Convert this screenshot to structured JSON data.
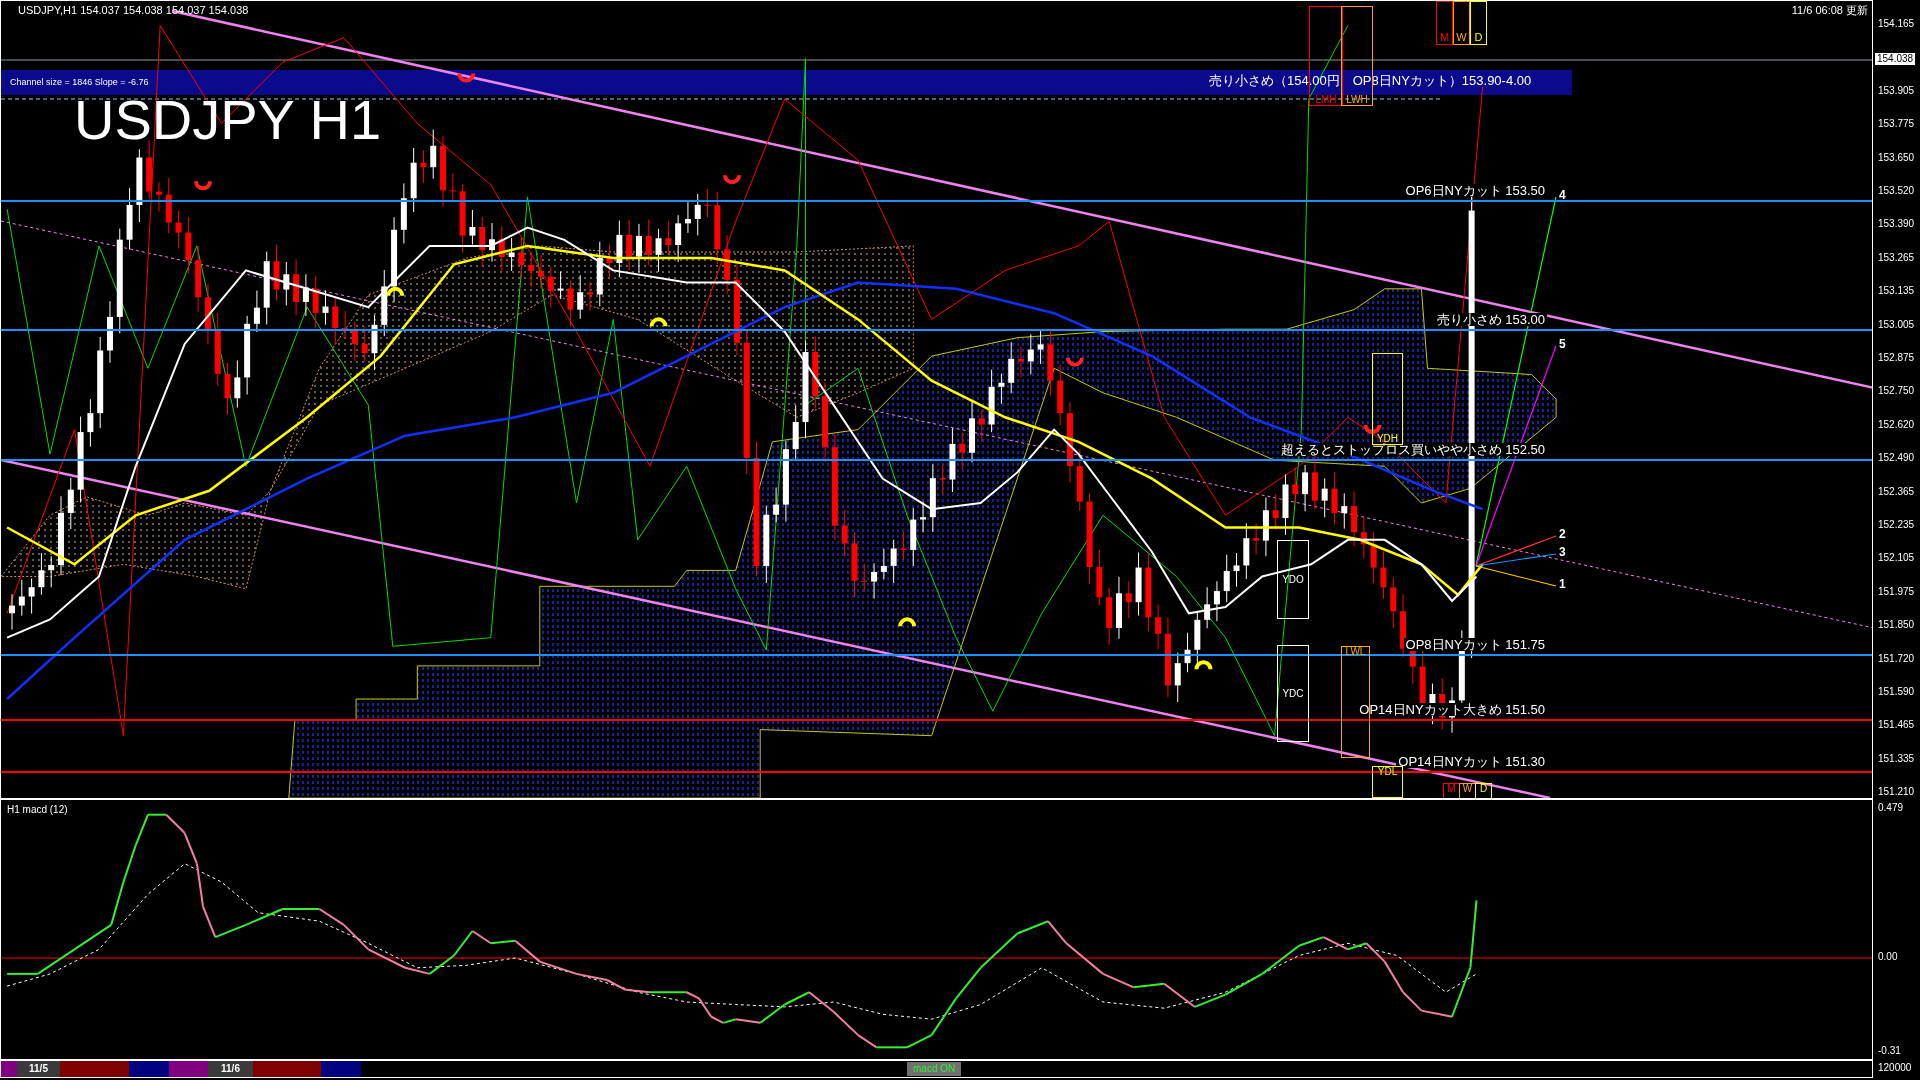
{
  "header": {
    "symbol_info": "USDJPY,H1  154.037 154.038 154.037 154.038",
    "updated": "11/6 06:08 更新"
  },
  "chart": {
    "channel_info": "Channel size = 1846 Slope = -6.76",
    "title": "USDJPY H1",
    "banner": "売り小さめ（154.00円　OP8日NYカット）153.90-4.00",
    "levels": [
      {
        "text": "OP6日NYカット 153.50",
        "color": "#1e90ff"
      },
      {
        "text": "売り小さめ 153.00",
        "color": "#1e90ff"
      },
      {
        "text": "超えるとストップロス買いやや小さめ 152.50",
        "color": "#1e90ff"
      },
      {
        "text": "OP8日NYカット 151.75",
        "color": "#1e90ff"
      },
      {
        "text": "OP14日NYカット大きめ 151.50",
        "color": "#ff0000"
      },
      {
        "text": "OP14日NYカット 151.30",
        "color": "#ff0000"
      }
    ],
    "period_boxes": [
      {
        "label": "M",
        "color": "#ff0000"
      },
      {
        "label": "W",
        "color": "#ffa500"
      },
      {
        "label": "D",
        "color": "#ffff00"
      }
    ],
    "period_boxes_lower": [
      {
        "label": "M",
        "color": "#ff0000"
      },
      {
        "label": "W",
        "color": "#ffa500"
      },
      {
        "label": "D",
        "color": "#ffff00"
      }
    ],
    "range_boxes": [
      {
        "label": "LMH",
        "color": "#ff0000"
      },
      {
        "label": "LWH",
        "color": "#ffa500"
      },
      {
        "label": "YDH",
        "color": "#ffff00"
      },
      {
        "label": "YDO",
        "color": "#ffffff"
      },
      {
        "label": "YDC",
        "color": "#ffffff"
      },
      {
        "label": "LWL",
        "color": "#ffa500"
      },
      {
        "label": "YDL",
        "color": "#ffff00"
      }
    ],
    "projection_labels": [
      "4",
      "5",
      "2",
      "3",
      "1"
    ]
  },
  "price_axis": {
    "current": "154.038",
    "ticks": [
      "154.165",
      "153.905",
      "153.775",
      "153.650",
      "153.520",
      "153.390",
      "153.265",
      "153.135",
      "153.005",
      "152.875",
      "152.750",
      "152.620",
      "152.490",
      "152.365",
      "152.235",
      "152.105",
      "151.975",
      "151.850",
      "151.720",
      "151.590",
      "151.465",
      "151.335",
      "151.210"
    ]
  },
  "macd": {
    "title": "H1 macd (12)",
    "axis": [
      "0.479",
      "0.00",
      "-0.31"
    ]
  },
  "footer": {
    "sessions": [
      {
        "color": "#800080"
      },
      {
        "color": "#3a3a3a",
        "label": "11/5"
      },
      {
        "color": "#800000"
      },
      {
        "color": "#000080"
      },
      {
        "color": "#800080"
      },
      {
        "color": "#3a3a3a",
        "label": "11/6"
      },
      {
        "color": "#800000"
      },
      {
        "color": "#000080"
      }
    ],
    "indicator_toggle": "macd ON",
    "volume_axis": "120000"
  }
}
